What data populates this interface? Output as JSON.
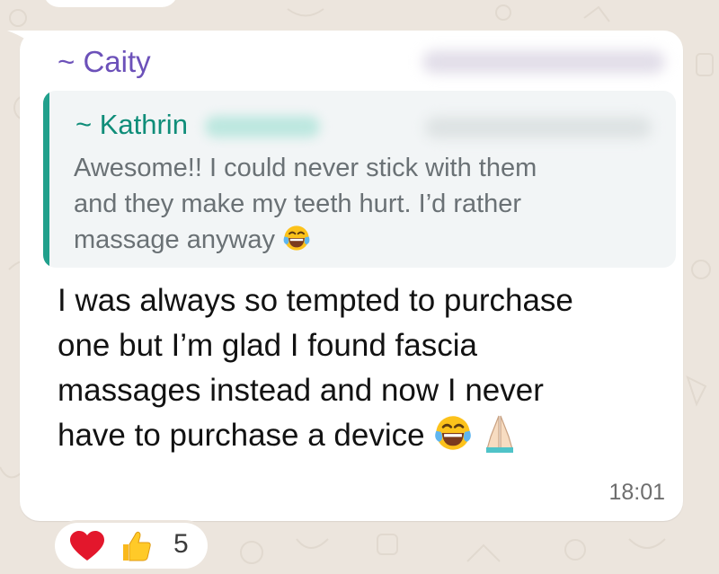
{
  "message": {
    "sender_name": "~ Caity",
    "quoted": {
      "author_name": "~ Kathrin",
      "text_lines": [
        "Awesome!! I could never stick with them",
        "and they make my teeth hurt. I’d rather",
        "massage anyway"
      ],
      "trailing_emoji": "face-with-tears-of-joy"
    },
    "body_lines": [
      "I was always so tempted to purchase",
      "one but I’m glad I found fascia",
      "massages instead and now I never",
      "have to purchase a device"
    ],
    "trailing_emojis": [
      "face-with-tears-of-joy",
      "folded-hands"
    ],
    "time": "18:01"
  },
  "reactions": {
    "emojis": [
      "red-heart",
      "thumbs-up"
    ],
    "count": "5"
  },
  "colors": {
    "chat_background": "#ece5dd",
    "bubble": "#ffffff",
    "sender_name": "#6c51b9",
    "quote_accent": "#21a08c",
    "quote_author": "#0f8d79",
    "quote_background": "#f2f5f6"
  }
}
